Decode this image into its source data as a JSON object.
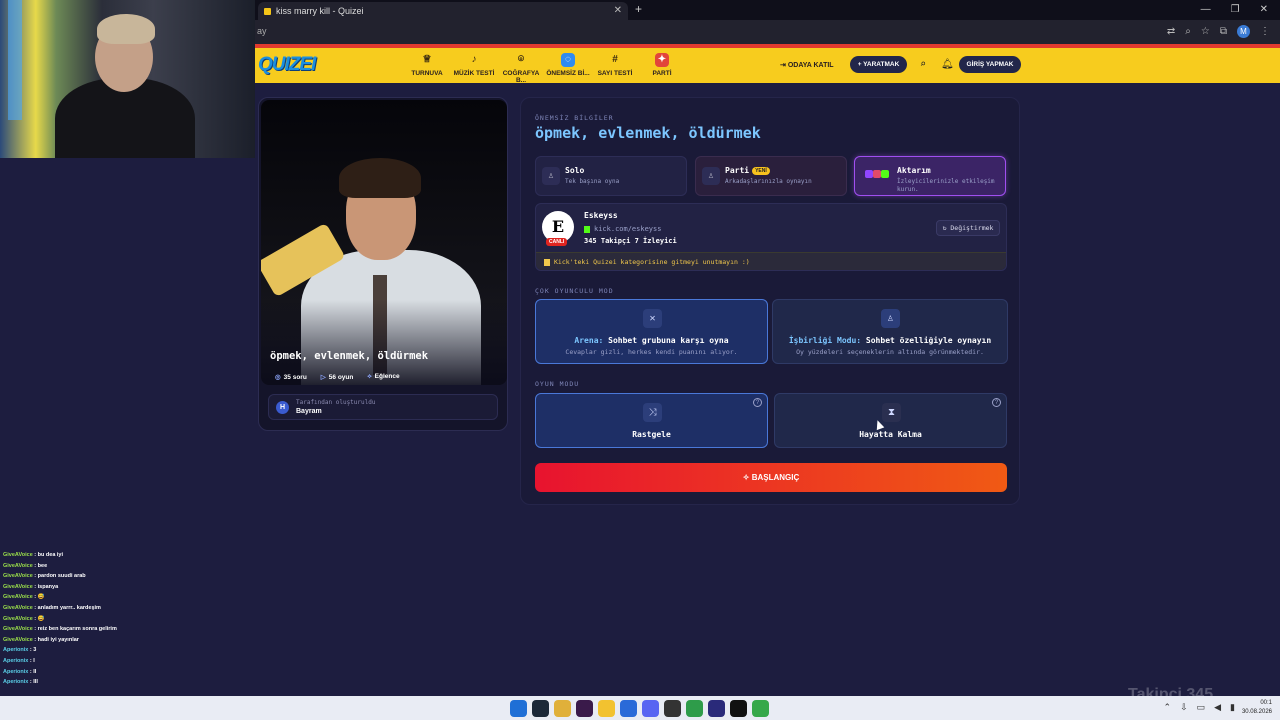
{
  "browser": {
    "tab_title": "kiss marry kill - Quizei",
    "url": "ay",
    "new_tab": "+",
    "profile": "M"
  },
  "header": {
    "logo": "QUIZEI",
    "nav": [
      {
        "label": "TURNUVA",
        "icon": "trophy-icon"
      },
      {
        "label": "MÜZİK TESTİ",
        "icon": "music-note-icon"
      },
      {
        "label": "COĞRAFYA B...",
        "icon": "map-pin-icon"
      },
      {
        "label": "ÖNEMSİZ Bİ...",
        "icon": "chat-bubble-icon"
      },
      {
        "label": "SAYI TESTİ",
        "icon": "hash-icon"
      },
      {
        "label": "PARTİ",
        "icon": "party-icon"
      }
    ],
    "join_room": "ODAYA KATIL",
    "create": "+ YARATMAK",
    "login": "GİRİŞ YAPMAK"
  },
  "quiz_card": {
    "title": "öpmek, evlenmek, öldürmek",
    "questions": "35 soru",
    "games": "56 oyun",
    "category": "Eğlence",
    "created_by_label": "Tarafından oluşturuldu",
    "creator": "Bayram",
    "creator_initial": "H"
  },
  "panel": {
    "category": "ÖNEMSİZ BİLGİLER",
    "title": "öpmek, evlenmek, öldürmek",
    "modes": [
      {
        "title": "Solo",
        "subtitle": "Tek başına oyna"
      },
      {
        "title": "Parti",
        "badge": "YENİ",
        "subtitle": "Arkadaşlarınızla oynayın"
      },
      {
        "title": "Aktarım",
        "subtitle": "İzleyicilerinizle etkileşim kurun."
      }
    ],
    "streamer": {
      "name": "Eskeyss",
      "link": "kick.com/eskeyss",
      "followers": "345 Takipçi",
      "viewers": "7 İzleyici",
      "live": "CANLI",
      "change": "Değiştirmek",
      "note": "Kick'teki Quizei kategorisine gitmeyi unutmayın :)"
    },
    "multiplayer_label": "ÇOK OYUNCULU MOD",
    "arena": {
      "prefix": "Arena:",
      "title": "Sohbet grubuna karşı oyna",
      "subtitle": "Cevaplar gizli, herkes kendi puanını alıyor."
    },
    "coop": {
      "prefix": "İşbirliği Modu:",
      "title": "Sohbet özelliğiyle oynayın",
      "subtitle": "Oy yüzdeleri seçeneklerin altında görünmektedir."
    },
    "game_mode_label": "OYUN MODU",
    "random": "Rastgele",
    "survival": "Hayatta Kalma",
    "start": "BAŞLANGIÇ"
  },
  "chat": [
    {
      "user": "GiveAVoice",
      "msg": "bu dea iyi"
    },
    {
      "user": "GiveAVoice",
      "msg": "bee"
    },
    {
      "user": "GiveAVoice",
      "msg": "pardon suudi arab"
    },
    {
      "user": "GiveAVoice",
      "msg": "ispanya"
    },
    {
      "user": "GiveAVoice",
      "msg": "😅"
    },
    {
      "user": "GiveAVoice",
      "msg": "anladım yarrr.. kardeşim"
    },
    {
      "user": "GiveAVoice",
      "msg": "😅"
    },
    {
      "user": "GiveAVoice",
      "msg": "reiz ben kaçarım sonra gelirim"
    },
    {
      "user": "GiveAVoice",
      "msg": "hadi iyi yayınlar"
    },
    {
      "user": "Aperionix",
      "msg": "3"
    },
    {
      "user": "Aperionix",
      "msg": "I"
    },
    {
      "user": "Aperionix",
      "msg": "II"
    },
    {
      "user": "Aperionix",
      "msg": "III"
    }
  ],
  "overlay": {
    "takip": "Takipçi 345"
  },
  "clock": {
    "time": "00:1",
    "date": "30.08.2026"
  }
}
